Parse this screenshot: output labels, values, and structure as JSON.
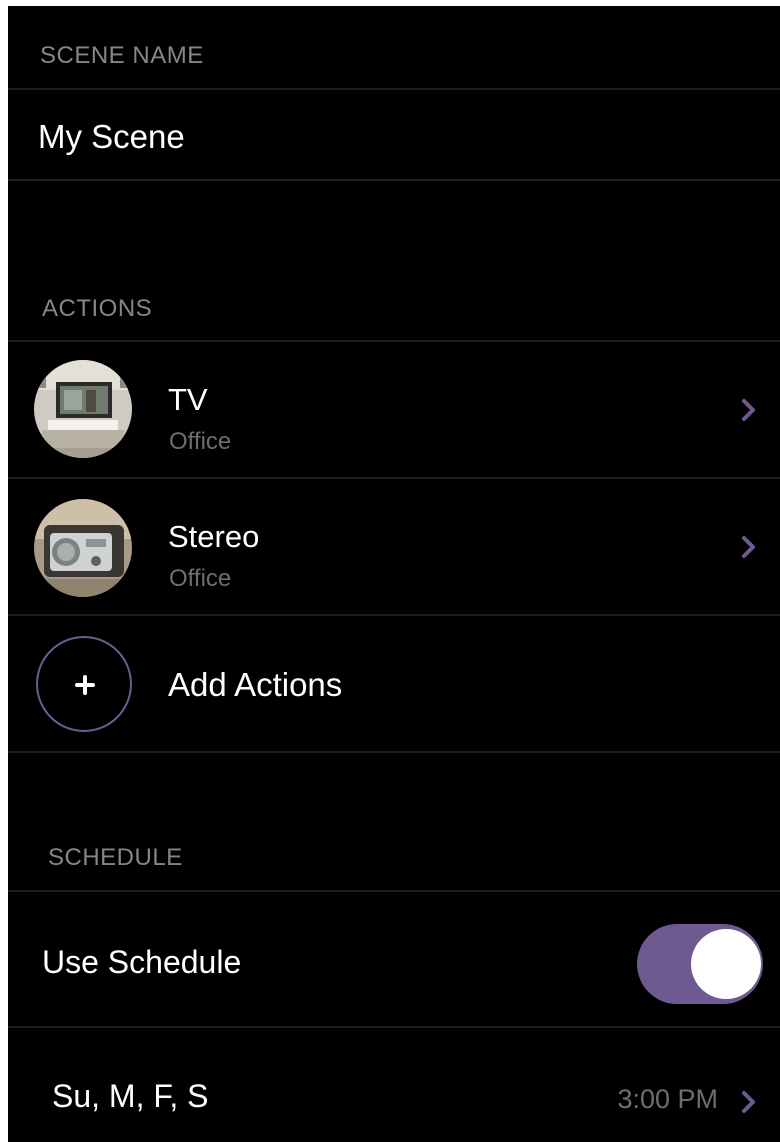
{
  "scene_name": {
    "section_label": "SCENE NAME",
    "value": "My Scene"
  },
  "actions": {
    "section_label": "ACTIONS",
    "items": [
      {
        "title": "TV",
        "room": "Office",
        "icon": "tv-thumbnail"
      },
      {
        "title": "Stereo",
        "room": "Office",
        "icon": "stereo-thumbnail"
      }
    ],
    "add_label": "Add Actions"
  },
  "schedule": {
    "section_label": "SCHEDULE",
    "use_schedule_label": "Use Schedule",
    "use_schedule_on": true,
    "days": "Su, M, F, S",
    "time": "3:00 PM"
  },
  "colors": {
    "background": "#000000",
    "accent": "#6e5a91",
    "secondary_text": "#6d6d72",
    "label_text": "#86868a"
  }
}
